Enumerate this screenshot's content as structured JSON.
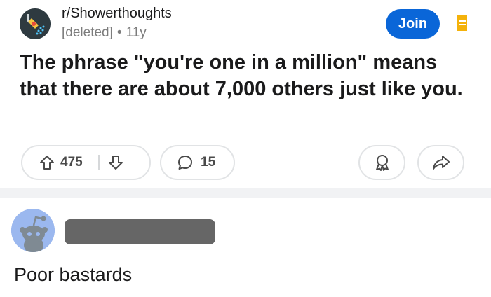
{
  "post": {
    "subreddit": "r/Showerthoughts",
    "author": "[deleted]",
    "separator": "•",
    "age": "11y",
    "join_label": "Join",
    "title": "The phrase \"you're one in a million\" means that there are about 7,000 others just like you.",
    "upvotes": "475",
    "comments": "15",
    "subreddit_icon": "showerhead-icon",
    "colors": {
      "join": "#0a66d8",
      "flag": "#f4b20b"
    }
  },
  "comment": {
    "author_redacted": true,
    "text": "Poor bastards"
  }
}
